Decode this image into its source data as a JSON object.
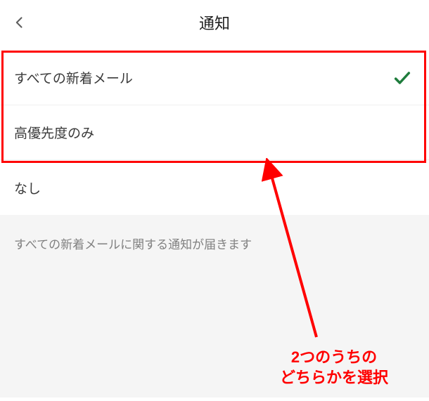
{
  "header": {
    "title": "通知"
  },
  "options": [
    {
      "label": "すべての新着メール",
      "selected": true
    },
    {
      "label": "高優先度のみ",
      "selected": false
    },
    {
      "label": "なし",
      "selected": false
    }
  ],
  "footer": {
    "note": "すべての新着メールに関する通知が届きます"
  },
  "annotation": {
    "text": "2つのうちの\nどちらかを選択",
    "color": "#ff0000"
  }
}
